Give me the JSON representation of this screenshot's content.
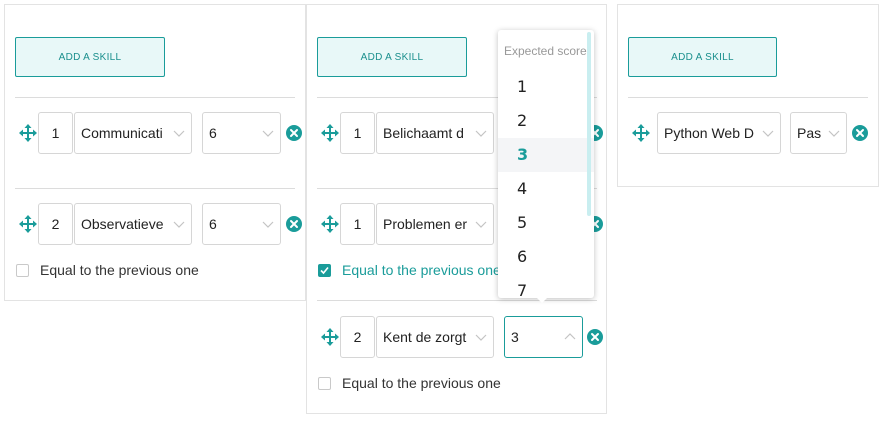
{
  "colors": {
    "accent": "#1a9c9a",
    "border": "#d6d6d6",
    "accent_bg": "#e8f8f8"
  },
  "panels": [
    {
      "add_button": "ADD A SKILL",
      "skills": [
        {
          "order": "1",
          "skill": "Communicati",
          "score": "6"
        },
        {
          "order": "2",
          "skill": "Observatieve",
          "score": "6"
        }
      ],
      "equal_checkbox": {
        "label": "Equal to the previous one",
        "checked": false
      }
    },
    {
      "add_button": "ADD A SKILL",
      "skills": [
        {
          "order": "1",
          "skill": "Belichaamt d",
          "score": ""
        },
        {
          "order": "1",
          "skill": "Problemen er",
          "score": ""
        },
        {
          "order": "2",
          "skill": "Kent de zorgt",
          "score": "3"
        }
      ],
      "equal_checkbox_1": {
        "label": "Equal to the previous one",
        "checked": true
      },
      "equal_checkbox_2": {
        "label": "Equal to the previous one",
        "checked": false
      }
    },
    {
      "add_button": "ADD A SKILL",
      "skills": [
        {
          "order": "",
          "skill": "Python Web D",
          "score": "Pas"
        }
      ]
    }
  ],
  "score_dropdown": {
    "header": "Expected score",
    "options": [
      "1",
      "2",
      "3",
      "4",
      "5",
      "6",
      "7"
    ],
    "selected": "3"
  },
  "icons": {
    "move": "move-arrows-icon",
    "remove": "remove-circle-icon",
    "chevron": "chevron-down-icon",
    "check": "checkmark-icon"
  }
}
